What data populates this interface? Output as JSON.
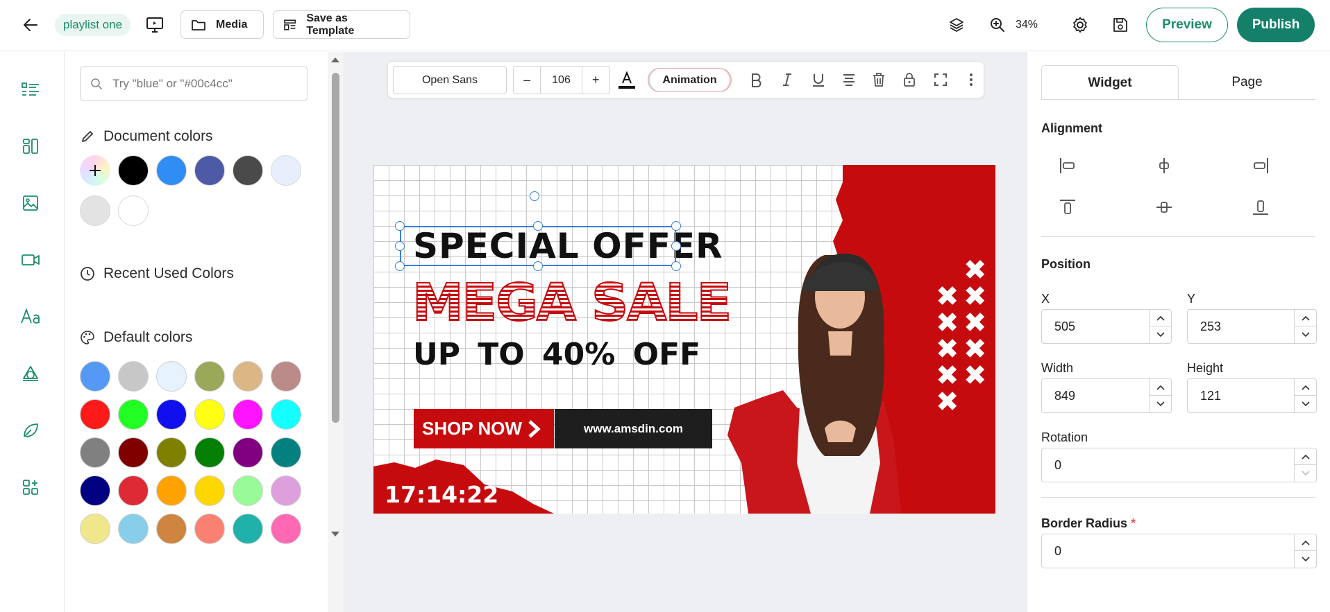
{
  "topbar": {
    "playlist_name": "playlist one",
    "media_label": "Media",
    "save_template_label": "Save as Template",
    "zoom_level": "34%",
    "preview_label": "Preview",
    "publish_label": "Publish"
  },
  "colors": {
    "search_placeholder": "Try \"blue\" or \"#00c4cc\"",
    "document_title": "Document colors",
    "recent_title": "Recent Used Colors",
    "default_title": "Default colors",
    "document_swatches": [
      "#000000",
      "#2f8df4",
      "#4c5aa8",
      "#4a4a4a",
      "#e8eefc",
      "#e3e3e3",
      "#ffffff"
    ],
    "default_swatches": [
      [
        "#5599f5",
        "#c7c7c7",
        "#e6f3fc",
        "#9aa85a",
        "#dcb685",
        "#bb8b8a"
      ],
      [
        "#ff1a1a",
        "#22ff22",
        "#1010ee",
        "#ffff14",
        "#ff14ff",
        "#14ffff"
      ],
      [
        "#808080",
        "#800000",
        "#808000",
        "#058005",
        "#800080",
        "#058080"
      ],
      [
        "#000080",
        "#dd2a35",
        "#ffa200",
        "#ffd700",
        "#98fb98",
        "#dda0dd"
      ],
      [
        "#f0e68c",
        "#87ceeb",
        "#cd853f",
        "#fa8072",
        "#20b2aa",
        "#ff69b4"
      ]
    ]
  },
  "toolbar": {
    "font_family": "Open Sans",
    "font_size": "106",
    "animation_label": "Animation"
  },
  "banner": {
    "special_offer": "SPECIAL OFFER",
    "mega_sale": "MEGA SALE",
    "discount": "UP TO 40% OFF",
    "shop_now": "SHOP NOW",
    "website": "www.amsdin.com",
    "timer": "17:14:22"
  },
  "properties": {
    "tab_widget": "Widget",
    "tab_page": "Page",
    "alignment_title": "Alignment",
    "position_title": "Position",
    "x_label": "X",
    "x_value": "505",
    "y_label": "Y",
    "y_value": "253",
    "width_label": "Width",
    "width_value": "849",
    "height_label": "Height",
    "height_value": "121",
    "rotation_label": "Rotation",
    "rotation_value": "0",
    "border_radius_label": "Border Radius",
    "border_radius_value": "0",
    "required_mark": "*"
  },
  "accent_color": "#14806a"
}
